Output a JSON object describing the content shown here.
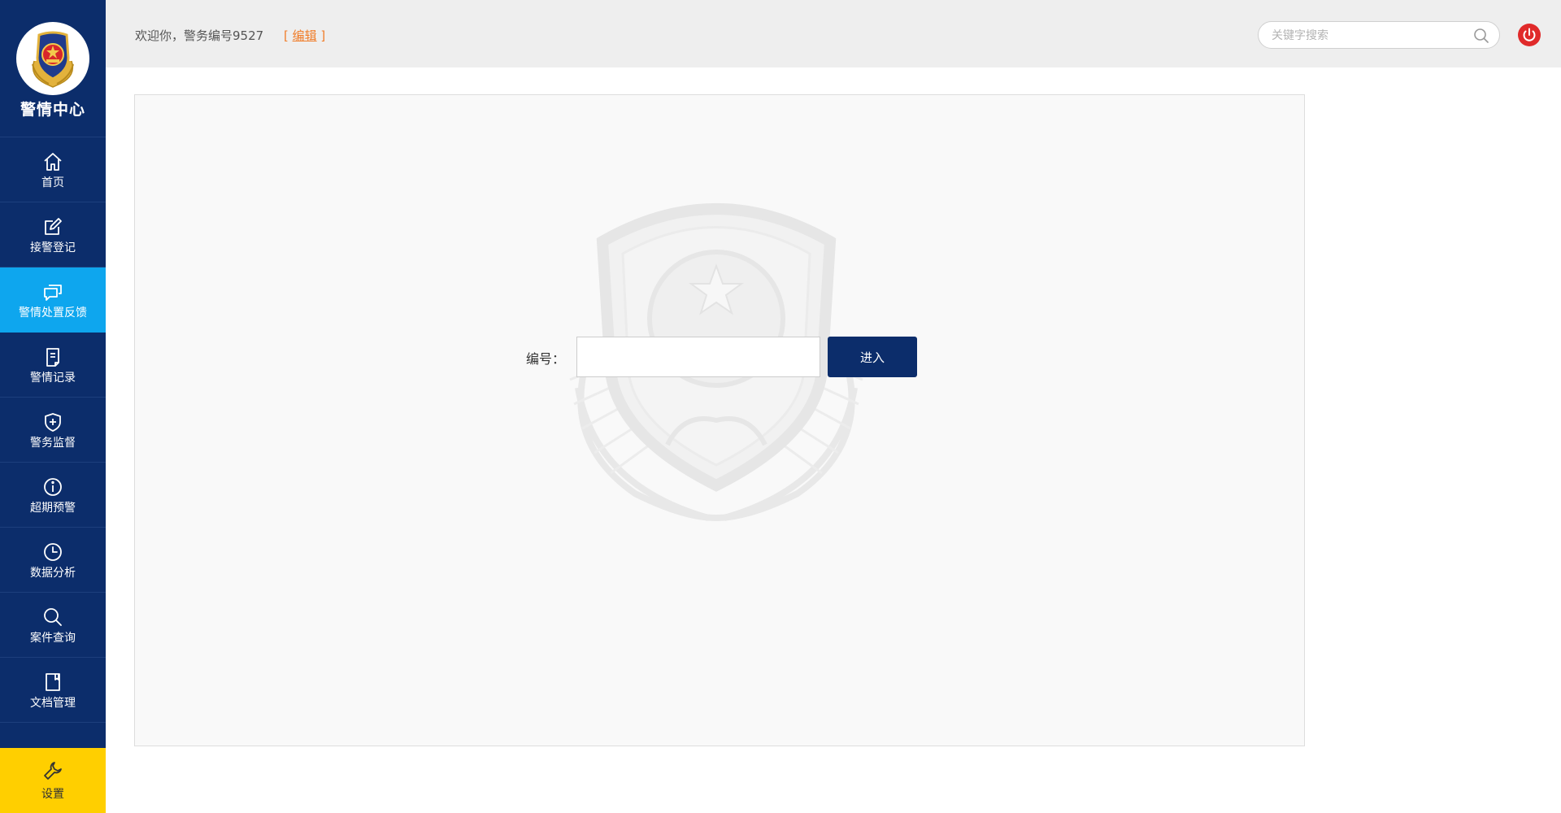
{
  "brand": {
    "title": "警情中心"
  },
  "sidebar": {
    "items": [
      {
        "label": "首页",
        "icon": "home-icon"
      },
      {
        "label": "接警登记",
        "icon": "edit-icon"
      },
      {
        "label": "警情处置反馈",
        "icon": "chat-icon",
        "active": true
      },
      {
        "label": "警情记录",
        "icon": "document-icon"
      },
      {
        "label": "警务监督",
        "icon": "shield-plus-icon"
      },
      {
        "label": "超期预警",
        "icon": "info-icon"
      },
      {
        "label": "数据分析",
        "icon": "clock-icon"
      },
      {
        "label": "案件查询",
        "icon": "search-icon"
      },
      {
        "label": "文档管理",
        "icon": "book-icon"
      }
    ],
    "settings": {
      "label": "设置",
      "icon": "wrench-icon"
    }
  },
  "header": {
    "welcome": "欢迎你，警务编号9527",
    "edit_open": "[ ",
    "edit_label": "编辑",
    "edit_close": " ]",
    "search_placeholder": "关键字搜索"
  },
  "form": {
    "label": "编号：",
    "input_value": "",
    "button_label": "进入"
  },
  "colors": {
    "sidebar_bg": "#0c2d6b",
    "active_bg": "#0ea6ee",
    "settings_bg": "#ffcf00",
    "accent_orange": "#f07d2a",
    "power_red": "#e02a2a",
    "button_bg": "#0c2d6b"
  }
}
